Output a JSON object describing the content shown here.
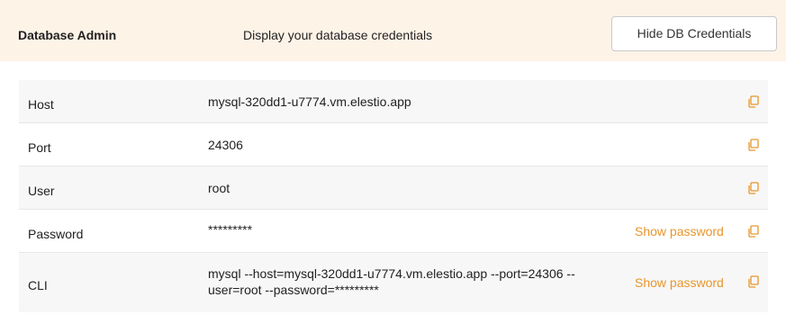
{
  "header": {
    "title": "Database Admin",
    "description": "Display your database credentials",
    "hide_button": "Hide DB Credentials"
  },
  "accent_color": "#e8962a",
  "header_bg": "#fdf3e7",
  "rows": [
    {
      "label": "Host",
      "value": "mysql-320dd1-u7774.vm.elestio.app"
    },
    {
      "label": "Port",
      "value": "24306"
    },
    {
      "label": "User",
      "value": "root"
    },
    {
      "label": "Password",
      "value": "*********",
      "action": "Show password"
    },
    {
      "label": "CLI",
      "value_line1": "mysql --host=mysql-320dd1-u7774.vm.elestio.app --port=24306 --",
      "value_line2": "user=root --password=*********",
      "action": "Show password"
    }
  ],
  "icons": {
    "copy": "copy-icon"
  }
}
